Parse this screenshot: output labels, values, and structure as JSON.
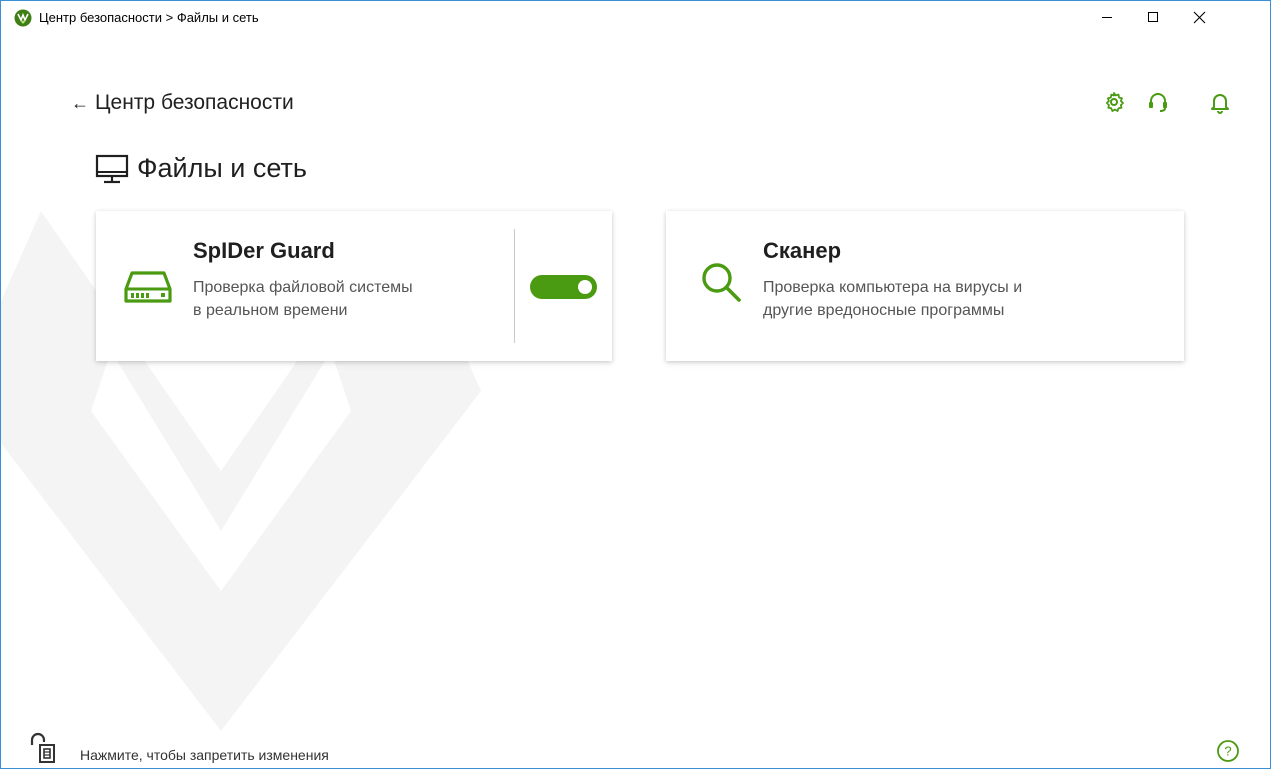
{
  "window": {
    "title": "Центр безопасности > Файлы и сеть",
    "controls": [
      "minimize-icon",
      "maximize-icon",
      "close-icon"
    ]
  },
  "header": {
    "back_label": "Центр безопасности",
    "icons": [
      "settings-icon",
      "support-icon",
      "notifications-icon"
    ]
  },
  "page": {
    "title": "Файлы и сеть"
  },
  "cards": [
    {
      "title": "SpIDer Guard",
      "description_line1": "Проверка файловой системы",
      "description_line2": "в реальном времени",
      "icon": "hard-drive-icon",
      "toggle_enabled": true
    },
    {
      "title": "Сканер",
      "description_line1": "Проверка компьютера на вирусы и",
      "description_line2": "другие вредоносные программы",
      "icon": "search-icon"
    }
  ],
  "footer": {
    "lock_text": "Нажмите, чтобы запретить изменения",
    "help_icon": "help-icon"
  },
  "colors": {
    "accent": "#4a9a12",
    "window_border": "#3b8fd6"
  }
}
